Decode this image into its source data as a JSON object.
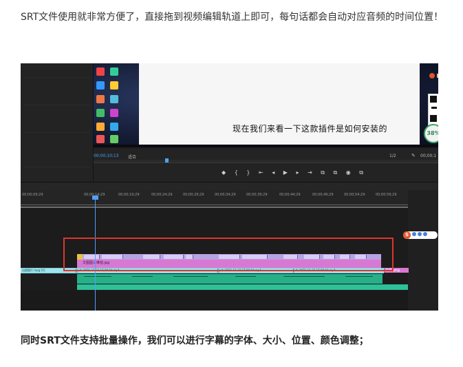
{
  "article": {
    "paragraph1": "SRT文件使用就非常方便了，直接拖到视频编辑轨道上即可，每句话都会自动对应音频的时间位置！",
    "paragraph2": "同时SRT文件支持批量操作，我们可以进行字幕的字体、大小、位置、颜色调整；"
  },
  "editor": {
    "video_caption": "现在我们来看一下这款插件是如何安装的",
    "percent_badge": "38%",
    "timecode": "00;00;10;13",
    "fit_label": "适合",
    "ratio_label": "1/2",
    "end_timecode": "00;00;1",
    "transport_controls": "◆ { } ⇤ ◂ ▶ ▸ ⇥ ⧉ ⧉ ◉ ⧉",
    "ruler_ticks": [
      "00;00;09;29",
      "00;00;14;29",
      "00;00;19;29",
      "00;00;24;29",
      "00;00;29;29",
      "00;00;34;29",
      "00;00;39;29",
      "00;00;44;29",
      "00;00;49;29",
      "00;00;54;29",
      "00;00;59;29"
    ],
    "pink_clip_label": "文图图三维拍.jpg",
    "pink_tail_label": "文件.png",
    "cyan_clips": [
      "出图图片.mpg [V]",
      "fx 2021-11-22 17.09.04.mp4",
      "fx 2021-11-22 17.09.04.mp4",
      "fx 2021-11-22 17.09.04.mp4"
    ],
    "tool_badge_letter": "S",
    "accent_color": "#4ea1ff",
    "selection_color": "#e0352b"
  }
}
